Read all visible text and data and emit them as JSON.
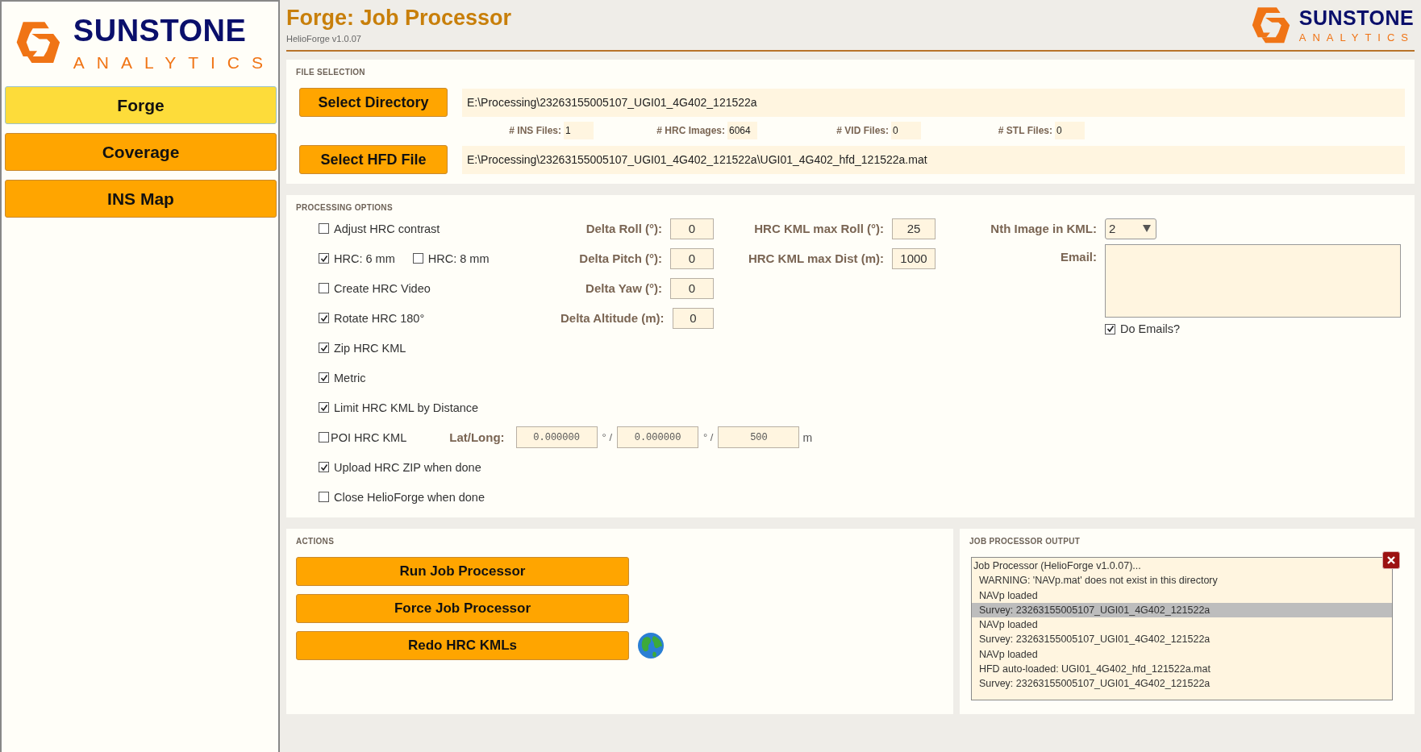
{
  "sidebar": {
    "logo": {
      "name": "SUNSTONE",
      "tagline": "ANALYTICS"
    },
    "nav": [
      {
        "label": "Forge",
        "selected": true
      },
      {
        "label": "Coverage",
        "selected": false
      },
      {
        "label": "INS Map",
        "selected": false
      }
    ]
  },
  "header": {
    "title": "Forge: Job Processor",
    "version": "HelioForge v1.0.07",
    "logo": {
      "name": "SUNSTONE",
      "tagline": "ANALYTICS"
    }
  },
  "file_selection": {
    "title": "FILE SELECTION",
    "directory": {
      "button": "Select Directory",
      "path": "E:\\Processing\\23263155005107_UGI01_4G402_121522a"
    },
    "counts": [
      {
        "label": "# INS Files:",
        "value": "1"
      },
      {
        "label": "# HRC Images:",
        "value": "6064"
      },
      {
        "label": "# VID Files:",
        "value": "0"
      },
      {
        "label": "# STL Files:",
        "value": "0"
      }
    ],
    "hfd": {
      "button": "Select HFD File",
      "path": "E:\\Processing\\23263155005107_UGI01_4G402_121522a\\UGI01_4G402_hfd_121522a.mat"
    }
  },
  "processing_options": {
    "title": "PROCESSING OPTIONS",
    "rows": [
      {
        "kind": "check",
        "items": [
          {
            "label": "Adjust HRC contrast",
            "checked": false
          }
        ]
      },
      {
        "kind": "check",
        "items": [
          {
            "label": "HRC: 6 mm",
            "checked": true
          },
          {
            "label": "HRC: 8 mm",
            "checked": false
          }
        ]
      },
      {
        "kind": "check",
        "items": [
          {
            "label": "Create HRC Video",
            "checked": false
          }
        ]
      },
      {
        "kind": "check",
        "items": [
          {
            "label": "Rotate HRC 180°",
            "checked": true
          }
        ]
      },
      {
        "kind": "check",
        "items": [
          {
            "label": "Zip HRC KML",
            "checked": true
          }
        ]
      },
      {
        "kind": "check",
        "items": [
          {
            "label": "Metric",
            "checked": true
          }
        ]
      },
      {
        "kind": "check",
        "items": [
          {
            "label": "Limit HRC KML by Distance",
            "checked": true
          }
        ]
      },
      {
        "kind": "poi",
        "items": [
          {
            "label": "POI HRC KML",
            "checked": false
          }
        ],
        "latlong": {
          "label": "Lat/Long:",
          "fields": [
            "0.000000",
            "0.000000",
            "500"
          ],
          "separators": [
            "° /",
            "° /"
          ],
          "unit": "m"
        }
      },
      {
        "kind": "check",
        "items": [
          {
            "label": "Upload HRC ZIP when done",
            "checked": true
          }
        ]
      },
      {
        "kind": "check",
        "items": [
          {
            "label": "Close HelioForge when done",
            "checked": false
          }
        ]
      }
    ],
    "deltas": [
      {
        "label": "Delta Roll (°):",
        "value": "0"
      },
      {
        "label": "Delta Pitch (°):",
        "value": "0"
      },
      {
        "label": "Delta Yaw (°):",
        "value": "0"
      },
      {
        "label": "Delta Altitude (m):",
        "value": "0"
      }
    ],
    "kml_limits": [
      {
        "label": "HRC KML max Roll (°):",
        "value": "25"
      },
      {
        "label": "HRC KML max Dist (m):",
        "value": "1000"
      }
    ],
    "nth_image": {
      "label": "Nth Image in KML:",
      "value": "2"
    },
    "email": {
      "label": "Email:"
    },
    "do_emails": {
      "label": "Do Emails?",
      "checked": true
    }
  },
  "actions": {
    "title": "ACTIONS",
    "buttons": [
      "Run Job Processor",
      "Force Job Processor",
      "Redo HRC KMLs"
    ]
  },
  "output": {
    "title": "JOB PROCESSOR OUTPUT",
    "lines": [
      {
        "text": "Job Processor (HelioForge v1.0.07)...",
        "selected": false
      },
      {
        "text": "  WARNING: 'NAVp.mat' does not exist in this directory",
        "selected": false
      },
      {
        "text": "  NAVp loaded",
        "selected": false
      },
      {
        "text": "  Survey: 23263155005107_UGI01_4G402_121522a",
        "selected": true
      },
      {
        "text": "  NAVp loaded",
        "selected": false
      },
      {
        "text": "  Survey: 23263155005107_UGI01_4G402_121522a",
        "selected": false
      },
      {
        "text": "  NAVp loaded",
        "selected": false
      },
      {
        "text": "  HFD auto-loaded: UGI01_4G402_hfd_121522a.mat",
        "selected": false
      },
      {
        "text": "  Survey: 23263155005107_UGI01_4G402_121522a",
        "selected": false
      }
    ]
  }
}
